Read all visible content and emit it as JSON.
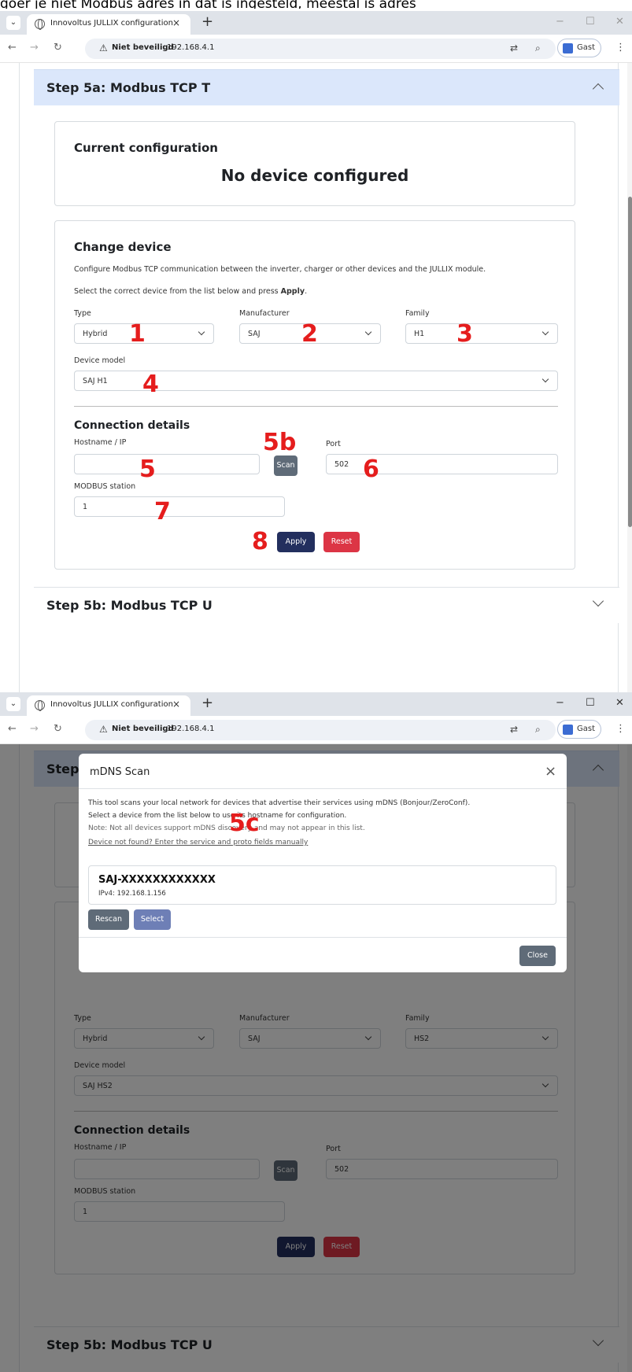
{
  "caption": "goer je niet Modbus adres in dat is ingesteld, meestal is adres",
  "browser": {
    "tab_title": "Innovoltus JULLIX configuration",
    "tab_close": "×",
    "new_tab": "+",
    "security_label": "Niet beveiligd",
    "url": "192.168.4.1",
    "profile_label": "Gast",
    "win_minimize": "−",
    "win_maximize": "☐",
    "win_close": "✕"
  },
  "shot1": {
    "step_title": "Step 5a: Modbus TCP T",
    "current_config_title": "Current configuration",
    "current_status": "No device configured",
    "change_title": "Change device",
    "change_desc": "Configure Modbus TCP communication between the inverter, charger or other devices and the JULLIX module.",
    "change_instr_prefix": "Select the correct device from the list below and press ",
    "change_instr_bold": "Apply",
    "change_instr_suffix": ".",
    "type_label": "Type",
    "type_value": "Hybrid",
    "manufacturer_label": "Manufacturer",
    "manufacturer_value": "SAJ",
    "family_label": "Family",
    "family_value": "H1",
    "model_label": "Device model",
    "model_value": "SAJ H1",
    "conn_title": "Connection details",
    "hostname_label": "Hostname / IP",
    "hostname_value": "",
    "scan_label": "Scan",
    "port_label": "Port",
    "port_value": "502",
    "station_label": "MODBUS station",
    "station_value": "1",
    "apply_label": "Apply",
    "reset_label": "Reset",
    "next_step_title": "Step 5b: Modbus TCP U"
  },
  "annotations": {
    "a1": "1",
    "a2": "2",
    "a3": "3",
    "a4": "4",
    "a5": "5",
    "a5b": "5b",
    "a6": "6",
    "a7": "7",
    "a8": "8",
    "a5c": "5c"
  },
  "shot2": {
    "step_title_partial": "Step",
    "type_label": "Type",
    "type_value": "Hybrid",
    "manufacturer_label": "Manufacturer",
    "manufacturer_value": "SAJ",
    "family_label": "Family",
    "family_value": "HS2",
    "model_label": "Device model",
    "model_value": "SAJ HS2",
    "conn_title": "Connection details",
    "hostname_label": "Hostname / IP",
    "scan_label": "Scan",
    "port_label": "Port",
    "port_value": "502",
    "station_label": "MODBUS station",
    "station_value": "1",
    "apply_label": "Apply",
    "reset_label": "Reset",
    "next_step_title": "Step 5b: Modbus TCP U"
  },
  "modal": {
    "title": "mDNS Scan",
    "close_x": "×",
    "line1": "This tool scans your local network for devices that advertise their services using mDNS (Bonjour/ZeroConf).",
    "line2": "Select a device from the list below to use its hostname for configuration.",
    "note": "Note: Not all devices support mDNS discovery and may not appear in this list.",
    "manual_link": "Device not found? Enter the service and proto fields manually",
    "device_name": "SAJ-XXXXXXXXXXXX",
    "device_ip": "IPv4: 192.168.1.156",
    "rescan_label": "Rescan",
    "select_label": "Select",
    "close_label": "Close"
  }
}
